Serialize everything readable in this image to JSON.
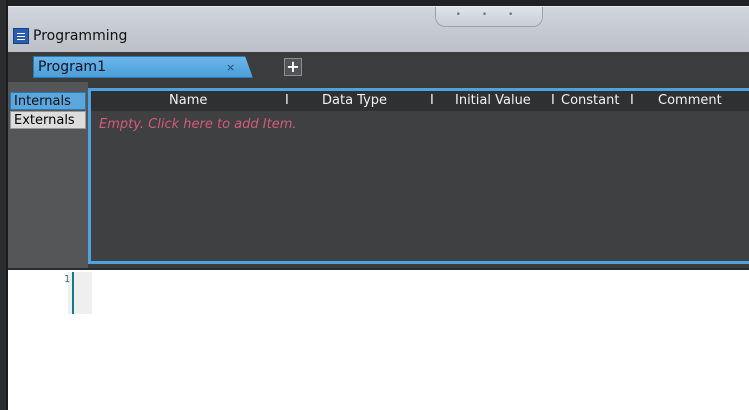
{
  "window": {
    "title": "Programming",
    "title_icon": "programming-window-icon",
    "grip_dots": "• • •"
  },
  "tabs": {
    "items": [
      {
        "label": "Program1",
        "close_label": "×"
      }
    ],
    "add_label": "+"
  },
  "variables": {
    "side_tabs": [
      "Internals",
      "Externals"
    ],
    "columns": [
      "Name",
      "Data Type",
      "Initial Value",
      "Constant",
      "Comment"
    ],
    "separator": "I",
    "empty_message": "Empty. Click here to add Item."
  },
  "editor": {
    "line_numbers": [
      "1"
    ]
  },
  "colors": {
    "accent_blue": "#4ca3e0",
    "empty_text": "#d55a7b",
    "panel_dark": "#3a3b3d",
    "line_marker": "#0e7e82"
  }
}
